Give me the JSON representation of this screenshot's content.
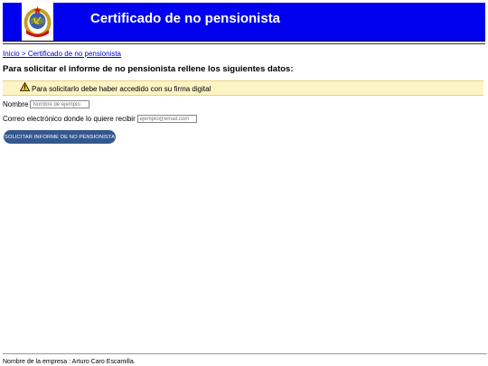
{
  "header": {
    "title": "Certificado de no pensionista",
    "background": "#0000ee",
    "logo_icon": "soviet-emblem-icon"
  },
  "breadcrumb": {
    "home": "Inicio",
    "separator": " > ",
    "current": "Certificado de no pensionista"
  },
  "form": {
    "heading": "Para solicitar el informe de no pensionista rellene los siguientes datos:",
    "notice": "Para solicitarlo debe haber accedido con su firma digital",
    "notice_icon": "warning-icon",
    "name_label": "Nombre",
    "name_placeholder": "Nombre de ejemplo",
    "email_label": "Correo electrónico donde lo quiere recibir",
    "email_placeholder": "ejemplo@email.com",
    "submit_label": "SOLICITAR INFORME DE NO PENSIONISTA",
    "submit_color": "#34578e"
  },
  "footer": {
    "text": "Nombre de la empresa : Arturo Caro Escamilla."
  }
}
